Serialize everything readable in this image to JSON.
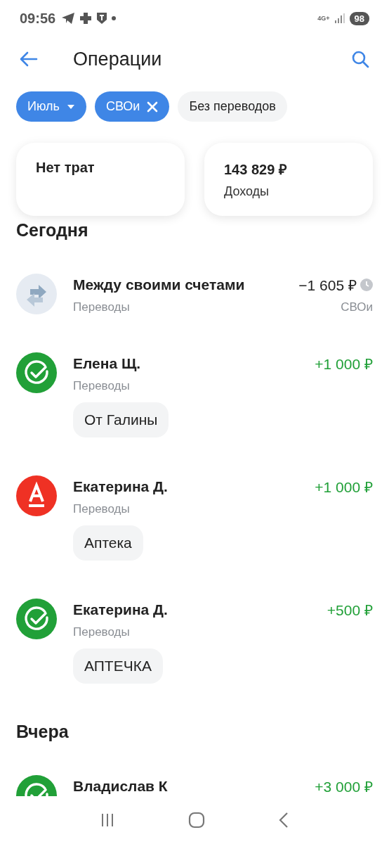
{
  "status_bar": {
    "time": "09:56",
    "network": "4G+",
    "battery": "98"
  },
  "header": {
    "title": "Операции"
  },
  "filters": [
    {
      "label": "Июль",
      "selected": true,
      "kind": "dropdown"
    },
    {
      "label": "СВОи",
      "selected": true,
      "kind": "removable"
    },
    {
      "label": "Без переводов",
      "selected": false,
      "kind": "toggle"
    }
  ],
  "summary": [
    {
      "title": "Нет трат"
    },
    {
      "title": "143 829 ₽",
      "subtitle": "Доходы"
    }
  ],
  "groups": [
    {
      "title": "Сегодня",
      "operations": [
        {
          "kind": "transfer",
          "name": "Между своими счетами",
          "category": "Переводы",
          "amount": "−1 605 ₽",
          "color": "#222222",
          "pending": true,
          "account": "СВОи"
        },
        {
          "kind": "sber",
          "name": "Елена Щ.",
          "category": "Переводы",
          "amount": "+1 000 ₽",
          "color": "#21a038",
          "pending": false,
          "note": "От Галины"
        },
        {
          "kind": "alfa",
          "name": "Екатерина Д.",
          "category": "Переводы",
          "amount": "+1 000 ₽",
          "color": "#21a038",
          "pending": false,
          "note": "Аптека"
        },
        {
          "kind": "sber",
          "name": "Екатерина Д.",
          "category": "Переводы",
          "amount": "+500 ₽",
          "color": "#21a038",
          "pending": false,
          "note": "АПТЕЧКА"
        }
      ]
    },
    {
      "title": "Вчера",
      "operations": [
        {
          "kind": "sber",
          "name": "Владислав К",
          "amount": "+3 000 ₽",
          "color": "#21a038",
          "pending": false
        }
      ]
    }
  ]
}
